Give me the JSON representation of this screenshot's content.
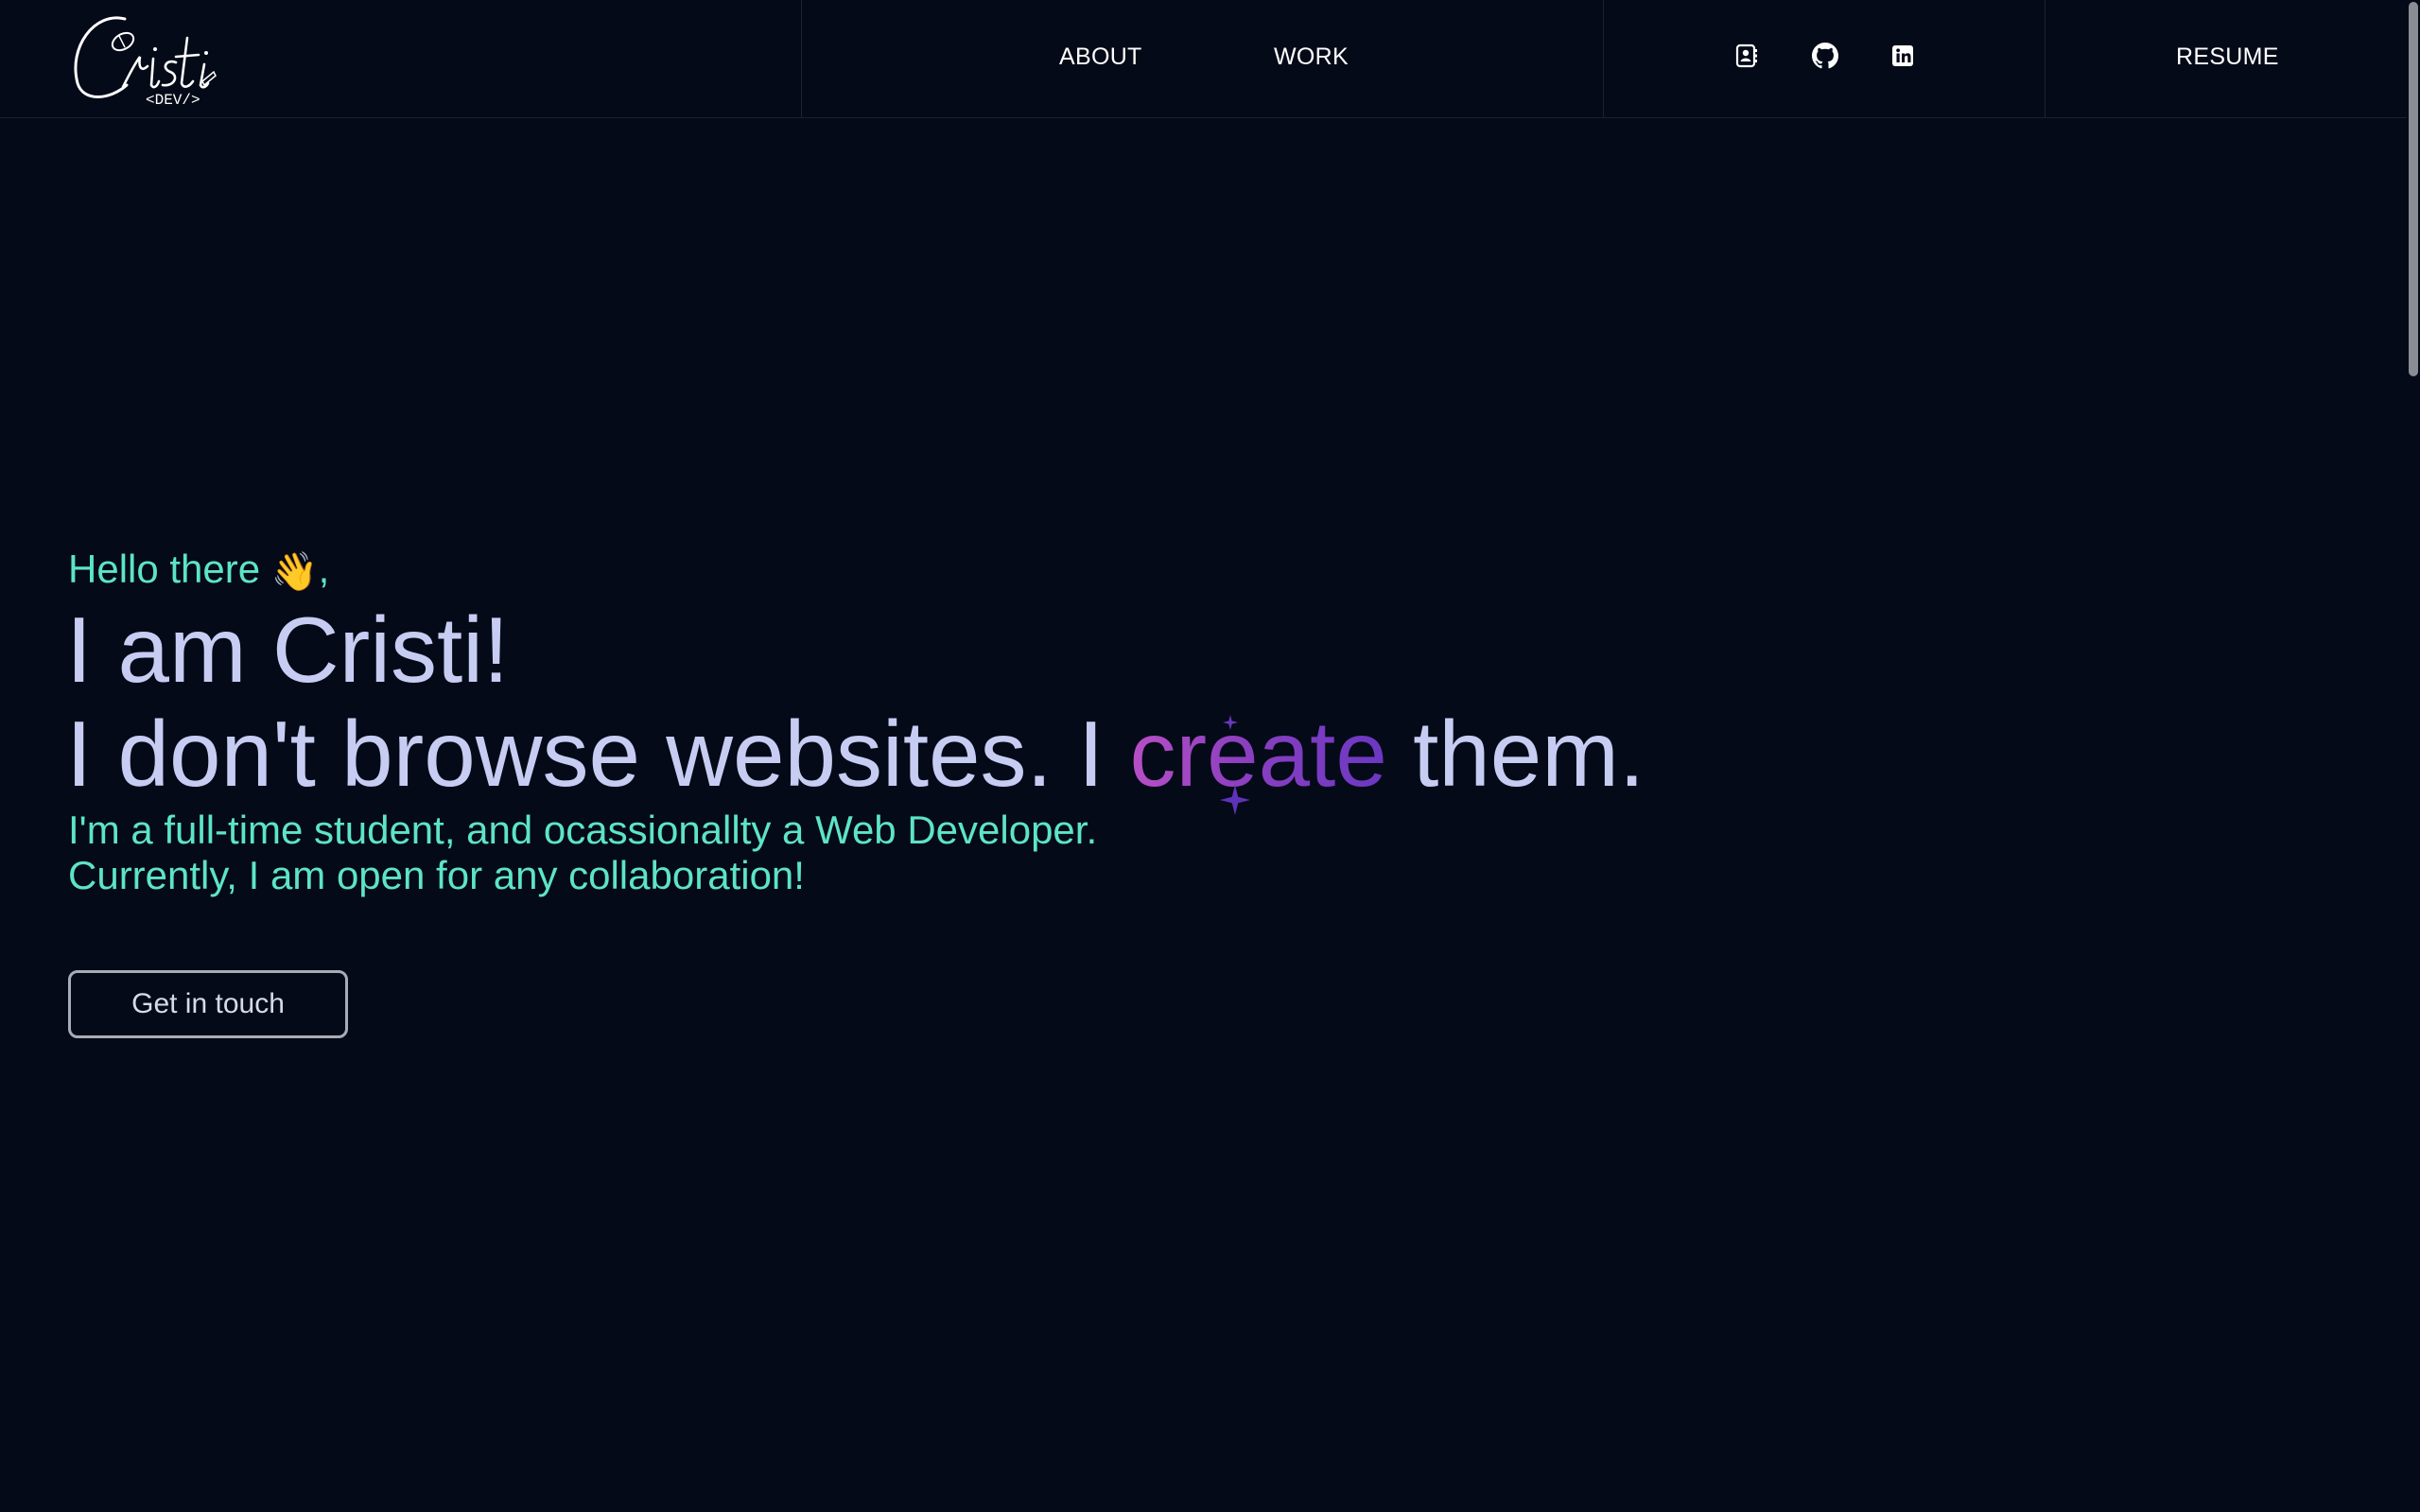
{
  "header": {
    "logo_text": "Cristi",
    "logo_subtext": "<DEV/>",
    "nav": [
      {
        "label": "ABOUT"
      },
      {
        "label": "WORK"
      }
    ],
    "social_icons": [
      {
        "name": "contact-card-icon"
      },
      {
        "name": "github-icon"
      },
      {
        "name": "linkedin-icon"
      }
    ],
    "resume_label": "RESUME"
  },
  "hero": {
    "greeting": "Hello there",
    "greeting_emoji": "👋",
    "greeting_suffix": ",",
    "headline": "I am Cristi!",
    "tagline_start": "I don't browse websites. I ",
    "tagline_highlight": "create",
    "tagline_end": " them.",
    "description_line1": "I'm a full-time student, and ocassionallty a Web Developer.",
    "description_line2": "Currently, I am open for any collaboration!",
    "cta_label": "Get in touch"
  },
  "colors": {
    "background": "#050a18",
    "accent_teal": "#5de4c7",
    "text_lavender": "#c7cdf2",
    "gradient_start": "#b84fc6",
    "gradient_end": "#6a38c2"
  }
}
